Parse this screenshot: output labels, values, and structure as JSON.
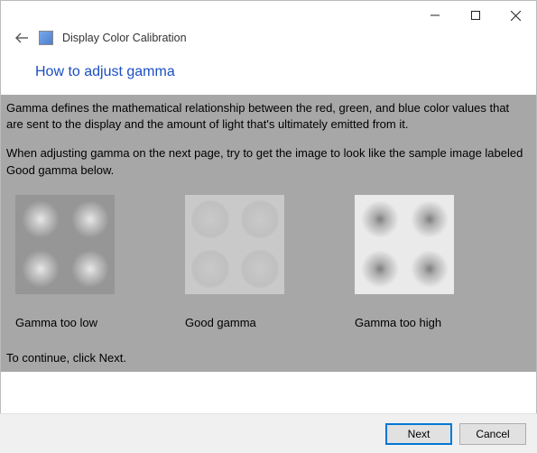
{
  "window": {
    "app_title": "Display Color Calibration"
  },
  "page": {
    "title": "How to adjust gamma",
    "intro": "Gamma defines the mathematical relationship between the red, green, and blue color values that are sent to the display and the amount of light that's ultimately emitted from it.",
    "instruction": "When adjusting gamma on the next page, try to get the image to look like the sample image labeled Good gamma below.",
    "continue": "To continue, click Next."
  },
  "samples": {
    "low": {
      "label": "Gamma too low"
    },
    "good": {
      "label": "Good gamma"
    },
    "high": {
      "label": "Gamma too high"
    }
  },
  "footer": {
    "next": "Next",
    "cancel": "Cancel"
  }
}
